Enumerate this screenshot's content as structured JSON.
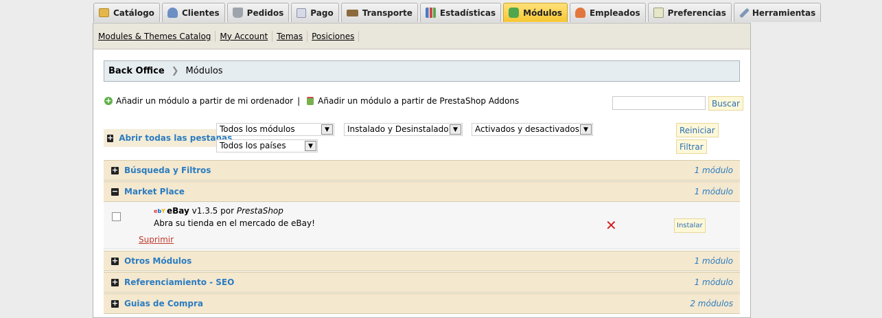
{
  "tabs": [
    {
      "label": "Catálogo",
      "icon": "catalog-icon"
    },
    {
      "label": "Clientes",
      "icon": "clients-icon"
    },
    {
      "label": "Pedidos",
      "icon": "orders-icon"
    },
    {
      "label": "Pago",
      "icon": "payment-icon"
    },
    {
      "label": "Transporte",
      "icon": "transport-icon"
    },
    {
      "label": "Estadísticas",
      "icon": "stats-icon"
    },
    {
      "label": "Módulos",
      "icon": "modules-icon",
      "active": true
    },
    {
      "label": "Empleados",
      "icon": "employees-icon"
    },
    {
      "label": "Preferencias",
      "icon": "preferences-icon"
    },
    {
      "label": "Herramientas",
      "icon": "tools-icon"
    }
  ],
  "subnav": [
    "Modules & Themes Catalog",
    "My Account",
    "Temas",
    "Posiciones"
  ],
  "breadcrumb": {
    "root": "Back Office",
    "current": "Módulos"
  },
  "add_links": {
    "from_computer": "Añadir un módulo a partir de mi ordenador",
    "separator": "|",
    "from_addons": "Añadir un módulo a partir de PrestaShop Addons"
  },
  "search": {
    "value": "",
    "button": "Buscar"
  },
  "filters": {
    "toggle_all": "Abrir todas las pestañas",
    "module_select": "Todos los módulos",
    "install_select": "Instalado y Desinstalado",
    "active_select": "Activados y desactivados",
    "country_select": "Todos los países",
    "reset_button": "Reiniciar",
    "filter_button": "Filtrar"
  },
  "groups": [
    {
      "title": "Búsqueda y Filtros",
      "count": "1 módulo",
      "expanded": false
    },
    {
      "title": "Market Place",
      "count": "1 módulo",
      "expanded": true
    },
    {
      "title": "Otros Módulos",
      "count": "1 módulo",
      "expanded": false
    },
    {
      "title": "Referenciamiento - SEO",
      "count": "1 módulo",
      "expanded": false
    },
    {
      "title": "Guias de Compra",
      "count": "2 módulos",
      "expanded": false
    }
  ],
  "module": {
    "logo": "ebY",
    "name": "eBay",
    "version": "v1.3.5 por",
    "author": "PrestaShop",
    "description": "Abra su tienda en el mercado de eBay!",
    "delete": "Suprimir",
    "status_icon": "red-x-icon",
    "install": "Instalar"
  },
  "colors": {
    "accent": "#2b7cc0",
    "active_tab": "#f6c632",
    "delete": "#c0392b",
    "status_x": "#d0211f"
  }
}
